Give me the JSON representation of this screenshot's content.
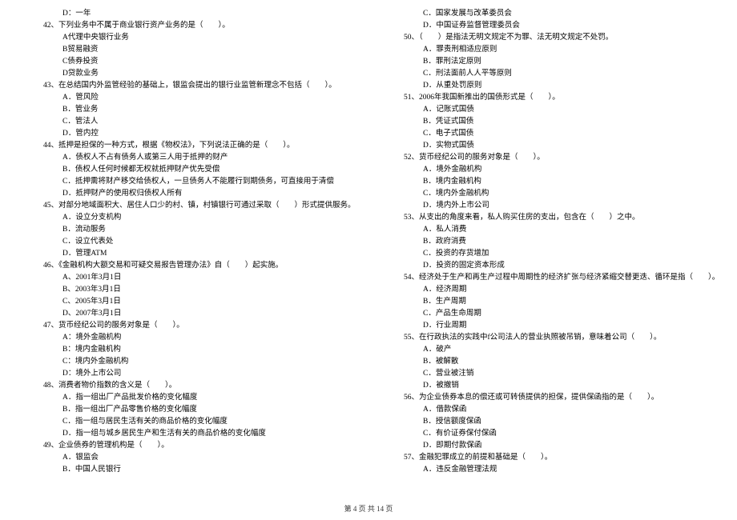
{
  "footer": "第 4 页 共 14 页",
  "left": [
    {
      "cls": "indent1",
      "t": "D：一年"
    },
    {
      "cls": "qnum",
      "t": "42、下列业务中不属于商业银行资产业务的是（　　）。"
    },
    {
      "cls": "indent1",
      "t": "A代理中央银行业务"
    },
    {
      "cls": "indent1",
      "t": "B贸易融资"
    },
    {
      "cls": "indent1",
      "t": "C债券投资"
    },
    {
      "cls": "indent1",
      "t": "D贷款业务"
    },
    {
      "cls": "qnum",
      "t": "43、在总结国内外监管经验的基础上，银监会提出的银行业监管新理念不包括（　　）。"
    },
    {
      "cls": "indent1",
      "t": "A．管风险"
    },
    {
      "cls": "indent1",
      "t": "B．管业务"
    },
    {
      "cls": "indent1",
      "t": "C．管法人"
    },
    {
      "cls": "indent1",
      "t": "D．管内控"
    },
    {
      "cls": "qnum",
      "t": "44、抵押是担保的一种方式，根据《物权法》，下列说法正确的是（　　）。"
    },
    {
      "cls": "indent1",
      "t": "A．债权人不占有债务人或第三人用于抵押的财产"
    },
    {
      "cls": "indent1",
      "t": "B．债权人任何时候都无权就抵押财产优先受偿"
    },
    {
      "cls": "indent1",
      "t": "C．抵押需将财产移交给债权人，一旦债务人不能履行到期债务，可直接用于清偿"
    },
    {
      "cls": "indent1",
      "t": "D．抵押财产的使用权归债权人所有"
    },
    {
      "cls": "qnum",
      "t": "45、对部分地域面积大、居住人口少的村、镇，村镇银行可通过采取（　　）形式提供服务。"
    },
    {
      "cls": "indent1",
      "t": "A．设立分支机构"
    },
    {
      "cls": "indent1",
      "t": "B．流动服务"
    },
    {
      "cls": "indent1",
      "t": "C．设立代表处"
    },
    {
      "cls": "indent1",
      "t": "D．管理ATM"
    },
    {
      "cls": "qnum",
      "t": "46、《金融机构大额交易和可疑交易报告管理办法》自（　　）起实施。"
    },
    {
      "cls": "indent1",
      "t": "A、2001年3月1日"
    },
    {
      "cls": "indent1",
      "t": "B、2003年3月1日"
    },
    {
      "cls": "indent1",
      "t": "C、2005年3月1日"
    },
    {
      "cls": "indent1",
      "t": "D、2007年3月1日"
    },
    {
      "cls": "qnum",
      "t": "47、货币经纪公司的服务对象是（　　）。"
    },
    {
      "cls": "indent1",
      "t": "A：境外金融机构"
    },
    {
      "cls": "indent1",
      "t": "B：境内金融机构"
    },
    {
      "cls": "indent1",
      "t": "C：境内外金融机构"
    },
    {
      "cls": "indent1",
      "t": "D：境外上市公司"
    },
    {
      "cls": "qnum",
      "t": "48、消费者物价指数的含义是（　　）。"
    },
    {
      "cls": "indent1",
      "t": "A．指一组出厂产品批发价格的变化幅度"
    },
    {
      "cls": "indent1",
      "t": "B．指一组出厂产品零售价格的变化幅度"
    },
    {
      "cls": "indent1",
      "t": "C．指一组与居民生活有关的商品价格的变化幅度"
    },
    {
      "cls": "indent1",
      "t": "D．指一组与城乡居民生产和生活有关的商品价格的变化幅度"
    },
    {
      "cls": "qnum",
      "t": "49、企业债券的管理机构是（　　）。"
    },
    {
      "cls": "indent1",
      "t": "A．银监会"
    },
    {
      "cls": "indent1",
      "t": "B．中国人民银行"
    }
  ],
  "right": [
    {
      "cls": "indent1",
      "t": "C．国家发展与改革委员会"
    },
    {
      "cls": "indent1",
      "t": "D．中国证券监督管理委员会"
    },
    {
      "cls": "qnum",
      "t": "50、（　　）是指法无明文规定不为罪、法无明文规定不处罚。"
    },
    {
      "cls": "indent1",
      "t": "A．罪责刑相适应原则"
    },
    {
      "cls": "indent1",
      "t": "B．罪刑法定原则"
    },
    {
      "cls": "indent1",
      "t": "C．刑法面前人人平等原则"
    },
    {
      "cls": "indent1",
      "t": "D．从重处罚原则"
    },
    {
      "cls": "qnum",
      "t": "51、2006年我国新推出的国债形式是（　　）。"
    },
    {
      "cls": "indent1",
      "t": "A．记账式国债"
    },
    {
      "cls": "indent1",
      "t": "B．凭证式国债"
    },
    {
      "cls": "indent1",
      "t": "C．电子式国债"
    },
    {
      "cls": "indent1",
      "t": "D．实物式国债"
    },
    {
      "cls": "qnum",
      "t": "52、货币经纪公司的服务对象是（　　）。"
    },
    {
      "cls": "indent1",
      "t": "A．境外金融机构"
    },
    {
      "cls": "indent1",
      "t": "B．境内金融机构"
    },
    {
      "cls": "indent1",
      "t": "C．境内外金融机构"
    },
    {
      "cls": "indent1",
      "t": "D．境内外上市公司"
    },
    {
      "cls": "qnum",
      "t": "53、从支出的角度来看，私人购买住房的支出，包含在（　　）之中。"
    },
    {
      "cls": "indent1",
      "t": "A．私人消费"
    },
    {
      "cls": "indent1",
      "t": "B．政府消费"
    },
    {
      "cls": "indent1",
      "t": "C．投资的存货增加"
    },
    {
      "cls": "indent1",
      "t": "D．投资的固定资本形成"
    },
    {
      "cls": "qnum",
      "t": "54、经济处于生产和再生产过程中周期性的经济扩张与经济紧缩交替更迭、循环是指（　　）。"
    },
    {
      "cls": "indent1",
      "t": "A．经济周期"
    },
    {
      "cls": "indent1",
      "t": "B．生产周期"
    },
    {
      "cls": "indent1",
      "t": "C．产品生命周期"
    },
    {
      "cls": "indent1",
      "t": "D．行业周期"
    },
    {
      "cls": "qnum",
      "t": "55、在行政执法的实践中f公司法人的营业执照被吊销，意味着公司（　　）。"
    },
    {
      "cls": "indent1",
      "t": "A．破产"
    },
    {
      "cls": "indent1",
      "t": "B．被解散"
    },
    {
      "cls": "indent1",
      "t": "C．营业被注销"
    },
    {
      "cls": "indent1",
      "t": "D．被撤销"
    },
    {
      "cls": "qnum",
      "t": "56、为企业债券本息的偿还或可转债提供的担保，提供保函指的是（　　）。"
    },
    {
      "cls": "indent1",
      "t": "A．借款保函"
    },
    {
      "cls": "indent1",
      "t": "B．授信额度保函"
    },
    {
      "cls": "indent1",
      "t": "C．有价证券保付保函"
    },
    {
      "cls": "indent1",
      "t": "D．即期付款保函"
    },
    {
      "cls": "qnum",
      "t": "57、金融犯罪成立的前提和基础是（　　）。"
    },
    {
      "cls": "indent1",
      "t": "A．违反金融管理法规"
    }
  ]
}
